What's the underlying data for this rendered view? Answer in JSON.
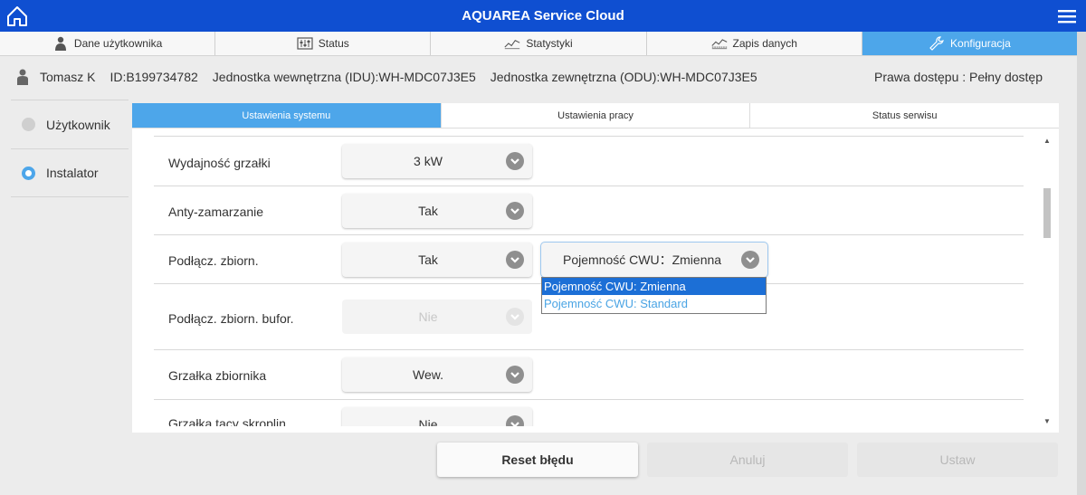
{
  "header": {
    "title": "AQUAREA Service Cloud",
    "bg_color": "#0f4fd1"
  },
  "top_tabs": [
    {
      "label": "Dane użytkownika",
      "icon": "person-icon",
      "active": false
    },
    {
      "label": "Status",
      "icon": "sliders-icon",
      "active": false
    },
    {
      "label": "Statystyki",
      "icon": "chart-line-icon",
      "active": false
    },
    {
      "label": "Zapis danych",
      "icon": "data-log-icon",
      "active": false
    },
    {
      "label": "Konfiguracja",
      "icon": "wrench-icon",
      "active": true
    }
  ],
  "user_info": {
    "name": "Tomasz K",
    "id": "ID:B199734782",
    "idu": "Jednostka wewnętrzna (IDU):WH-MDC07J3E5",
    "odu": "Jednostka zewnętrzna (ODU):WH-MDC07J3E5",
    "rights": "Prawa dostępu : Pełny dostęp"
  },
  "sidebar": {
    "items": [
      {
        "label": "Użytkownik",
        "selected": false
      },
      {
        "label": "Instalator",
        "selected": true
      }
    ]
  },
  "sub_tabs": [
    {
      "label": "Ustawienia systemu",
      "active": true
    },
    {
      "label": "Ustawienia pracy",
      "active": false
    },
    {
      "label": "Status serwisu",
      "active": false
    }
  ],
  "settings": [
    {
      "label": "Wydajność grzałki",
      "value": "3 kW",
      "enabled": true
    },
    {
      "label": "Anty-zamarzanie",
      "value": "Tak",
      "enabled": true
    },
    {
      "label": "Podłącz. zbiorn.",
      "value": "Tak",
      "enabled": true
    },
    {
      "label": "Podłącz. zbiorn. bufor.",
      "value": "Nie",
      "enabled": false
    },
    {
      "label": "Grzałka zbiornika",
      "value": "Wew.",
      "enabled": true
    },
    {
      "label": "Grzałka tacy skroplin",
      "value": "Nie",
      "enabled": true
    }
  ],
  "cwu_select": {
    "value": "Pojemność CWU：Zmienna",
    "options": [
      "Pojemność CWU:  Zmienna",
      "Pojemność CWU:  Standard"
    ],
    "selected_index": 0
  },
  "buttons": {
    "reset": "Reset błędu",
    "cancel": "Anuluj",
    "set": "Ustaw"
  },
  "colors": {
    "accent": "#4da6ea",
    "selected_option": "#1c6fd6"
  }
}
